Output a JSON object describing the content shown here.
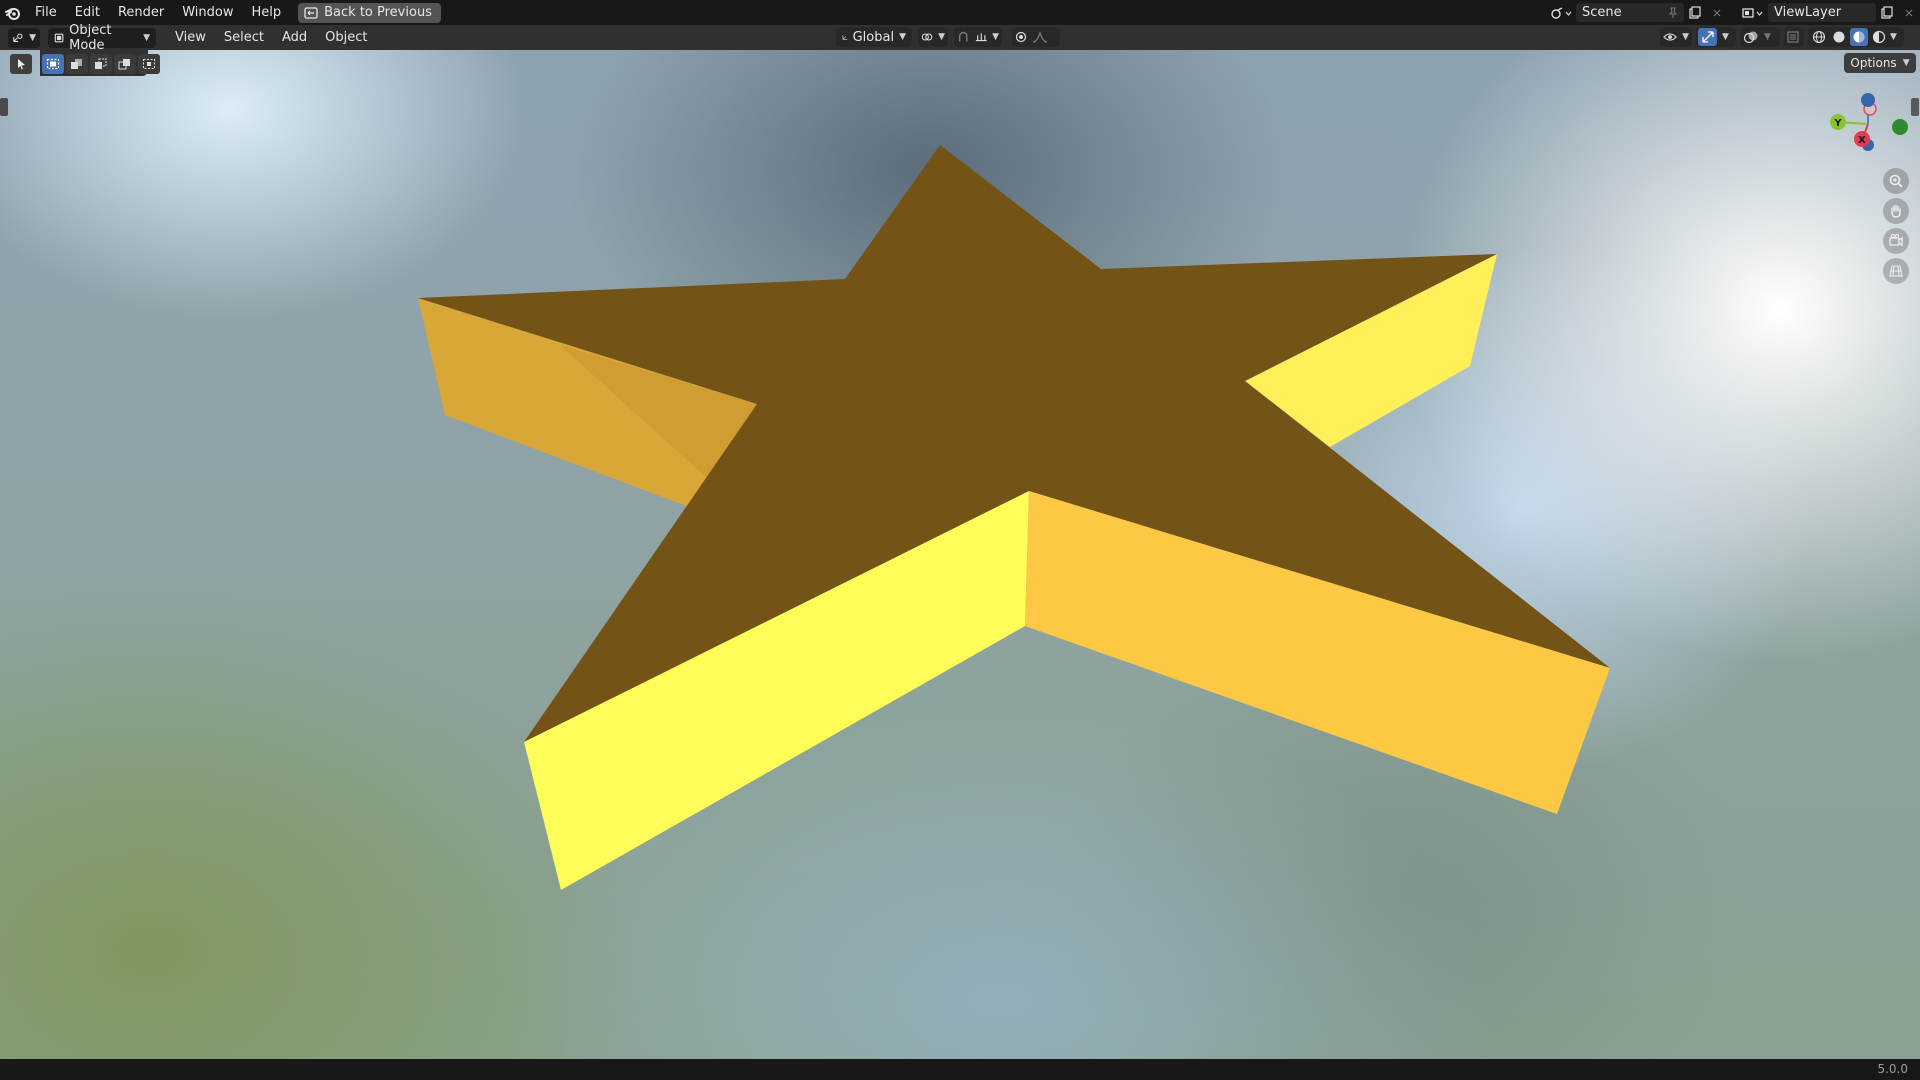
{
  "topbar": {
    "menus": [
      "File",
      "Edit",
      "Render",
      "Window",
      "Help"
    ],
    "back_button": "Back to Previous",
    "scene_name": "Scene",
    "view_layer_name": "ViewLayer"
  },
  "header": {
    "mode": "Object Mode",
    "menus": [
      "View",
      "Select",
      "Add",
      "Object"
    ],
    "transform_orientation": "Global"
  },
  "viewport": {
    "options_label": "Options",
    "gizmo_labels": {
      "y": "Y",
      "x": "X"
    },
    "object_colors": {
      "top_face": "#735316",
      "front_face": "#fffd58",
      "side_face": "#fdc945",
      "left_face": "#d9a638",
      "right_arm_face": "#fff05a"
    }
  },
  "statusbar": {
    "version": "5.0.0"
  }
}
